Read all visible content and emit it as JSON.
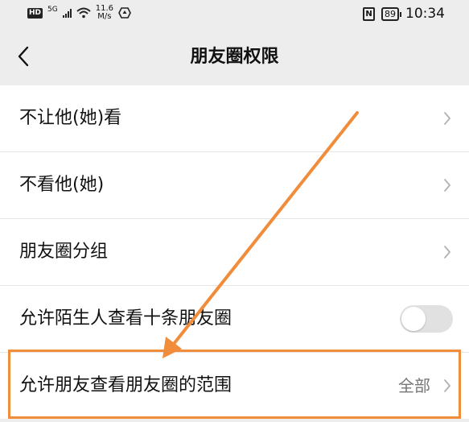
{
  "status_bar": {
    "network_badge": "HD",
    "signal_label": "5G",
    "speed_value": "11.6",
    "speed_unit": "M/s",
    "battery": "89",
    "time": "10:34"
  },
  "nav": {
    "title": "朋友圈权限"
  },
  "rows": [
    {
      "label": "不让他(她)看"
    },
    {
      "label": "不看他(她)"
    },
    {
      "label": "朋友圈分组"
    },
    {
      "label": "允许陌生人查看十条朋友圈"
    },
    {
      "label": "允许朋友查看朋友圈的范围",
      "value": "全部"
    }
  ],
  "colors": {
    "annotation": "#f08c3a",
    "toggle_off": "#e1e1e1",
    "background": "#ededed"
  }
}
